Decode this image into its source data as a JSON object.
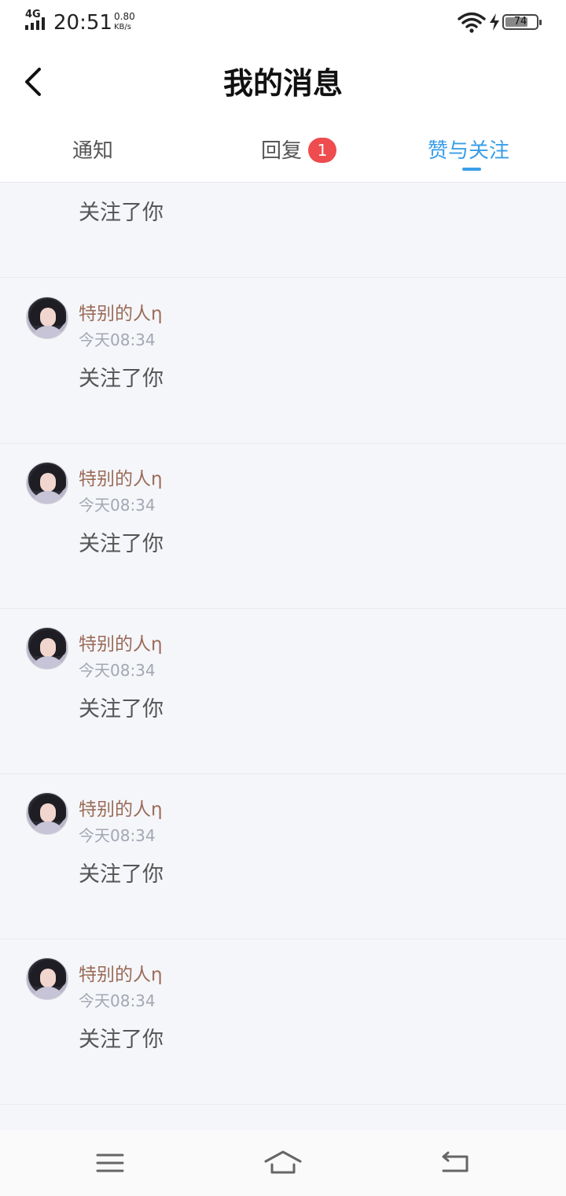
{
  "status_bar": {
    "network": "4G",
    "time": "20:51",
    "speed_value": "0.80",
    "speed_unit": "KB/s",
    "battery_level": "74",
    "battery_fraction": 0.74
  },
  "header": {
    "title": "我的消息"
  },
  "tabs": [
    {
      "label": "通知",
      "active": false
    },
    {
      "label": "回复",
      "badge": "1",
      "active": false
    },
    {
      "label": "赞与关注",
      "active": true
    }
  ],
  "messages": [
    {
      "action": "关注了你"
    },
    {
      "user": "特别的人η",
      "time": "今天08:34",
      "action": "关注了你"
    },
    {
      "user": "特别的人η",
      "time": "今天08:34",
      "action": "关注了你"
    },
    {
      "user": "特别的人η",
      "time": "今天08:34",
      "action": "关注了你"
    },
    {
      "user": "特别的人η",
      "time": "今天08:34",
      "action": "关注了你"
    },
    {
      "user": "特别的人η",
      "time": "今天08:34",
      "action": "关注了你"
    }
  ],
  "icons": {
    "back": "chevron-left-icon",
    "nav_menu": "menu-icon",
    "nav_home": "home-icon",
    "nav_back": "return-icon"
  },
  "colors": {
    "accent": "#3a9ee8",
    "badge": "#ef4c4f",
    "username": "#9b6b58",
    "background": "#f5f6fa"
  }
}
